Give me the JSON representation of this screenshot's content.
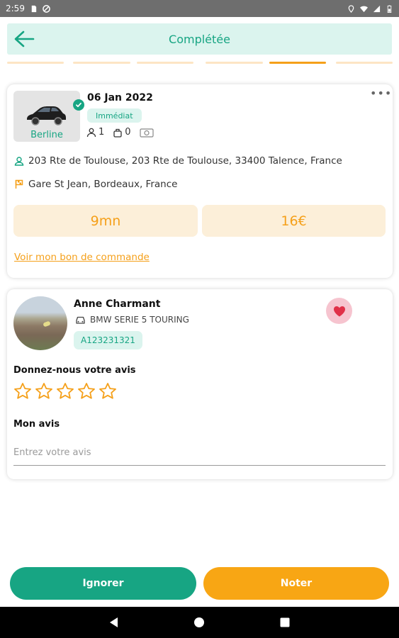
{
  "status_bar": {
    "time": "2:59"
  },
  "header": {
    "title": "Complétée"
  },
  "progress": {
    "step_count": 6,
    "active_step": 5
  },
  "trip": {
    "vehicle_type": "Berline",
    "date": "06 Jan 2022",
    "mode": "Immédiat",
    "passengers": "1",
    "luggage": "0",
    "pickup_address": "203 Rte de Toulouse, 203 Rte de Toulouse, 33400 Talence, France",
    "dropoff_address": "Gare St Jean, Bordeaux, France",
    "duration": "9mn",
    "price": "16€",
    "order_link": "Voir mon bon de commande"
  },
  "driver": {
    "name": "Anne Charmant",
    "car_model": "BMW SERIE 5 TOURING",
    "plate": "A123231321",
    "favorite": true
  },
  "review": {
    "rating_label": "Donnez-nous votre avis",
    "rating": 0,
    "max_rating": 5,
    "review_label": "Mon avis",
    "placeholder": "Entrez votre avis"
  },
  "actions": {
    "ignore_label": "Ignorer",
    "rate_label": "Noter"
  },
  "colors": {
    "accent_green": "#17a583",
    "accent_orange": "#f5a01a",
    "header_bg": "#dbf4ee",
    "pill_bg": "#fcefd9"
  }
}
